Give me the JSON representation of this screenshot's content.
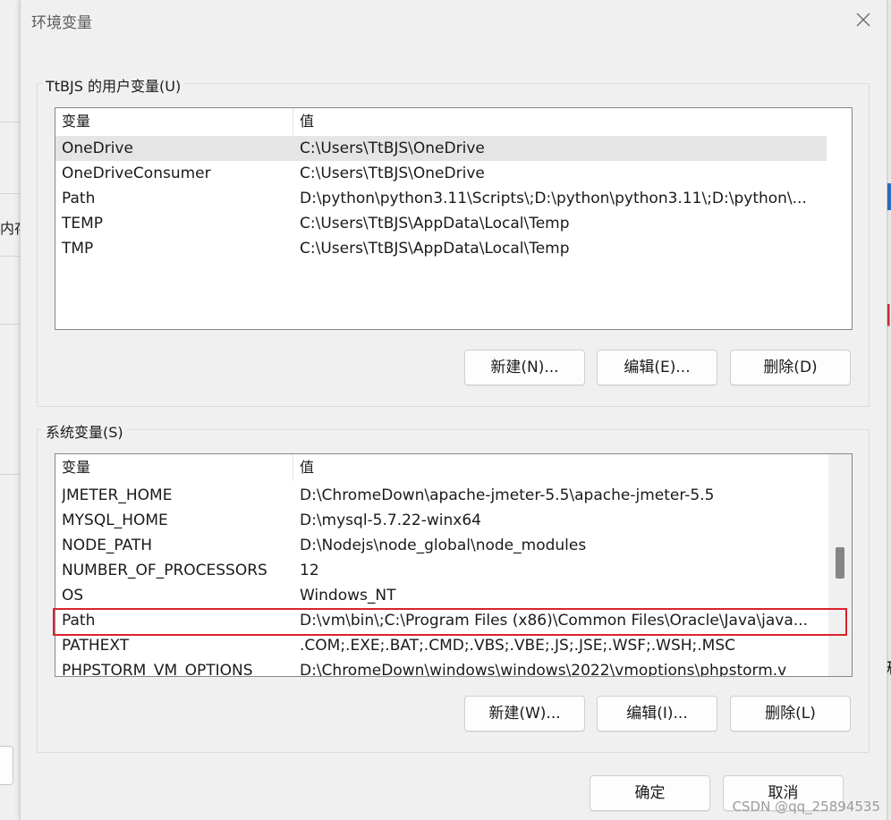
{
  "background": {
    "left_text": "内存",
    "right_text": "无"
  },
  "dialog": {
    "title": "环境变量",
    "user_section": {
      "label": "TtBJS 的用户变量(U)",
      "columns": [
        "变量",
        "值"
      ],
      "rows": [
        {
          "name": "OneDrive",
          "value": "C:\\Users\\TtBJS\\OneDrive"
        },
        {
          "name": "OneDriveConsumer",
          "value": "C:\\Users\\TtBJS\\OneDrive"
        },
        {
          "name": "Path",
          "value": "D:\\python\\python3.11\\Scripts\\;D:\\python\\python3.11\\;D:\\python\\..."
        },
        {
          "name": "TEMP",
          "value": "C:\\Users\\TtBJS\\AppData\\Local\\Temp"
        },
        {
          "name": "TMP",
          "value": "C:\\Users\\TtBJS\\AppData\\Local\\Temp"
        }
      ],
      "buttons": {
        "new": "新建(N)...",
        "edit": "编辑(E)...",
        "delete": "删除(D)"
      }
    },
    "system_section": {
      "label": "系统变量(S)",
      "columns": [
        "变量",
        "值"
      ],
      "rows": [
        {
          "name": "JMETER_HOME",
          "value": "D:\\ChromeDown\\apache-jmeter-5.5\\apache-jmeter-5.5"
        },
        {
          "name": "MYSQL_HOME",
          "value": "D:\\mysql-5.7.22-winx64"
        },
        {
          "name": "NODE_PATH",
          "value": "D:\\Nodejs\\node_global\\node_modules"
        },
        {
          "name": "NUMBER_OF_PROCESSORS",
          "value": "12"
        },
        {
          "name": "OS",
          "value": "Windows_NT"
        },
        {
          "name": "Path",
          "value": "D:\\vm\\bin\\;C:\\Program Files (x86)\\Common Files\\Oracle\\Java\\java..."
        },
        {
          "name": "PATHEXT",
          "value": ".COM;.EXE;.BAT;.CMD;.VBS;.VBE;.JS;.JSE;.WSF;.WSH;.MSC"
        },
        {
          "name": "PHPSTORM_VM_OPTIONS",
          "value": "D:\\ChromeDown\\windows\\windows\\2022\\vmoptions\\phpstorm.v"
        }
      ],
      "buttons": {
        "new": "新建(W)...",
        "edit": "编辑(I)...",
        "delete": "删除(L)"
      }
    },
    "footer": {
      "ok": "确定",
      "cancel": "取消"
    }
  },
  "watermark": "CSDN @qq_25894535",
  "colors": {
    "highlight": "#d9232d",
    "selected_row": "#e5e5e5"
  }
}
